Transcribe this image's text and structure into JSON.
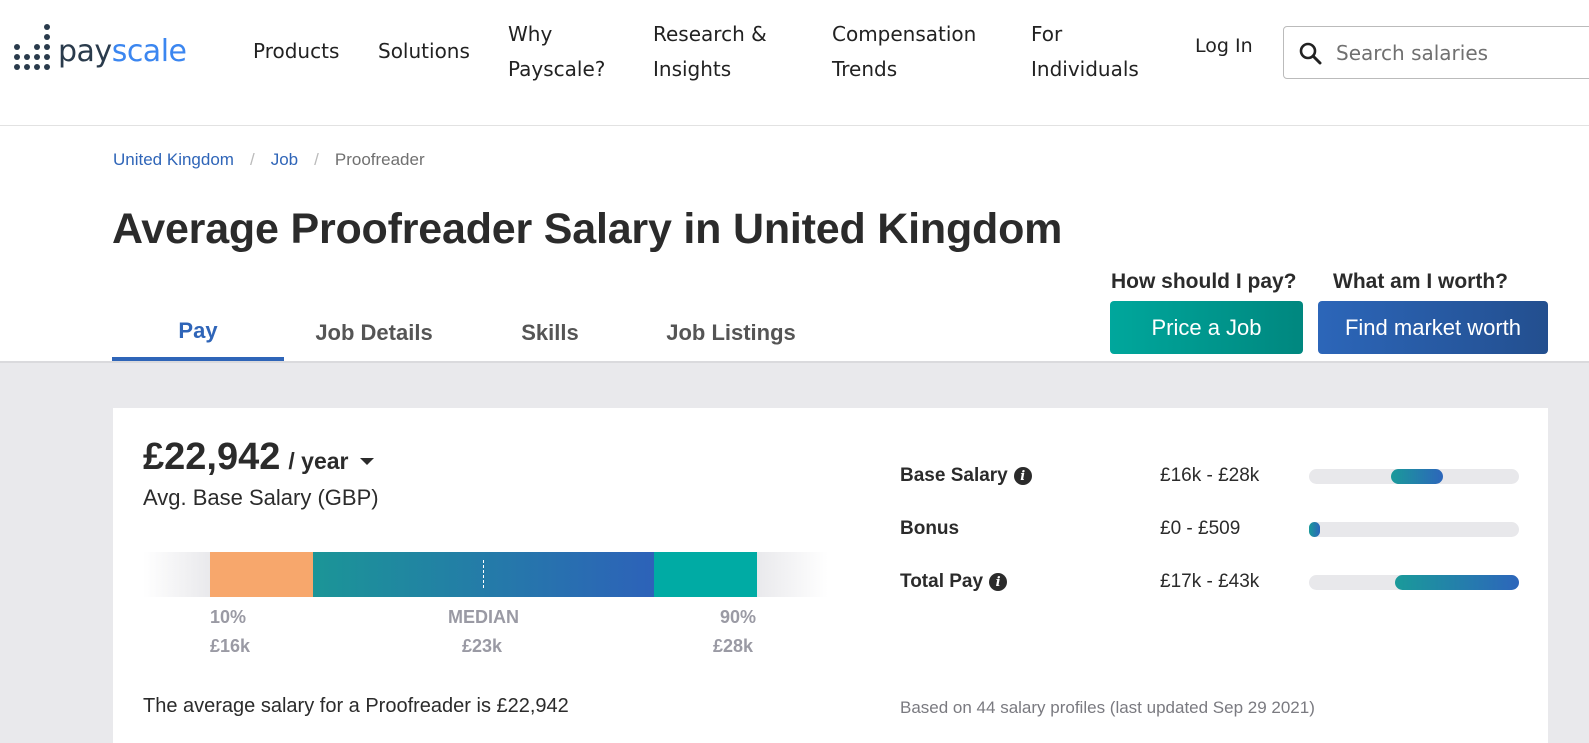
{
  "header": {
    "logo": {
      "part1": "pay",
      "part2": "scale"
    },
    "nav": [
      {
        "label": "Products"
      },
      {
        "label": "Solutions"
      },
      {
        "label": "Why Payscale?"
      },
      {
        "label": "Research & Insights"
      },
      {
        "label": "Compensation Trends"
      },
      {
        "label": "For Individuals"
      }
    ],
    "login_label": "Log In",
    "search": {
      "placeholder": "Search salaries",
      "value": ""
    }
  },
  "breadcrumb": [
    {
      "label": "United Kingdom"
    },
    {
      "label": "Job"
    },
    {
      "label": "Proofreader"
    }
  ],
  "page_title": "Average Proofreader Salary in United Kingdom",
  "tabs": [
    {
      "label": "Pay",
      "active": true
    },
    {
      "label": "Job Details",
      "active": false
    },
    {
      "label": "Skills",
      "active": false
    },
    {
      "label": "Job Listings",
      "active": false
    }
  ],
  "cta": {
    "pay_question": "How should I pay?",
    "price_button": "Price a Job",
    "worth_question": "What am I worth?",
    "worth_button": "Find market worth"
  },
  "salary": {
    "amount": "£22,942",
    "period": "/ year",
    "label": "Avg. Base Salary (GBP)"
  },
  "distribution": {
    "p10_label": "10%",
    "p10_value": "£16k",
    "median_label": "MEDIAN",
    "median_value": "£23k",
    "p90_label": "90%",
    "p90_value": "£28k",
    "colors": {
      "low": "#f7a76c",
      "mid_start": "#1b9597",
      "mid_end": "#2d62b9",
      "high": "#00aba4"
    }
  },
  "pay_rows": [
    {
      "name": "Base Salary",
      "info": true,
      "range": "£16k - £28k",
      "fill_start_pct": 39,
      "fill_end_pct": 64
    },
    {
      "name": "Bonus",
      "info": false,
      "range": "£0 - £509",
      "fill_start_pct": 0,
      "fill_end_pct": 5
    },
    {
      "name": "Total Pay",
      "info": true,
      "range": "£17k - £43k",
      "fill_start_pct": 41,
      "fill_end_pct": 100
    }
  ],
  "summary": "The average salary for a Proofreader is £22,942",
  "profiles_note": "Based on 44 salary profiles (last updated Sep 29 2021)"
}
